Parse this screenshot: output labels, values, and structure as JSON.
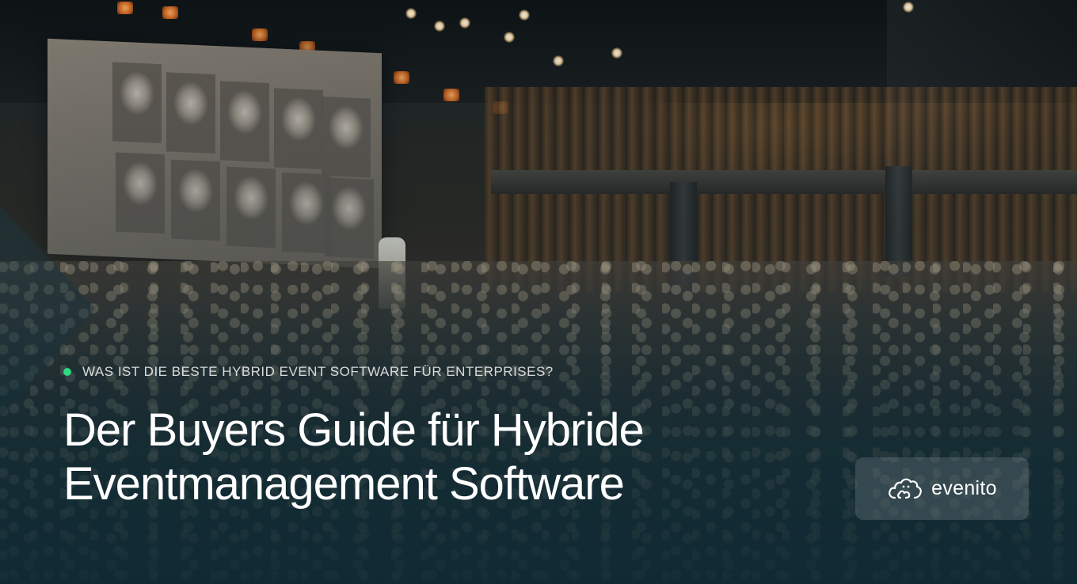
{
  "hero": {
    "eyebrow": "WAS IST DIE BESTE HYBRID EVENT SOFTWARE FÜR ENTERPRISES?",
    "headline_line1": "Der Buyers Guide für Hybride",
    "headline_line2": "Eventmanagement Software",
    "accent_color": "#2fd883",
    "background_color": "#102a33"
  },
  "brand": {
    "logo_text": "evenito",
    "logo_icon": "evenito-cloud-icon"
  },
  "background_image": {
    "icon": "conference-hall-photo"
  }
}
